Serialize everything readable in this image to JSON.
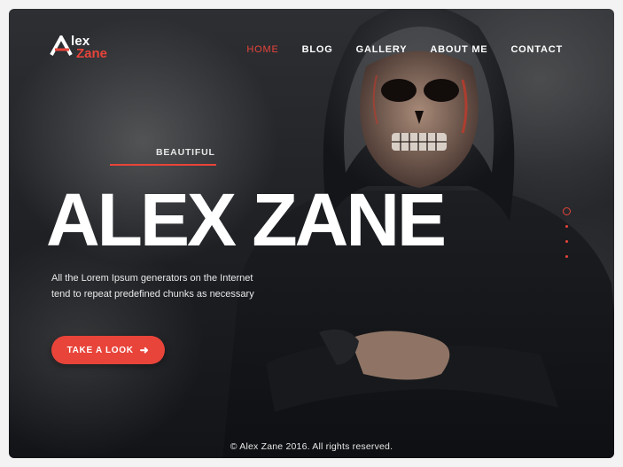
{
  "brand": {
    "line1": "lex",
    "line2": "Zane",
    "mark": "A"
  },
  "nav": {
    "items": [
      "HOME",
      "BLOG",
      "GALLERY",
      "ABOUT ME",
      "CONTACT"
    ],
    "active": "HOME"
  },
  "hero": {
    "eyebrow": "BEAUTIFUL",
    "title": "ALEX ZANE",
    "description": "All the Lorem Ipsum generators on the Internet tend to repeat predefined chunks as necessary",
    "cta_label": "TAKE A LOOK",
    "cta_icon": "arrow-right-icon"
  },
  "slider": {
    "count": 4,
    "active_index": 0
  },
  "footer": {
    "copyright": "© Alex Zane 2016. All rights reserved."
  },
  "colors": {
    "accent": "#e8443a",
    "background": "#1d1f23",
    "text": "#ffffff"
  }
}
